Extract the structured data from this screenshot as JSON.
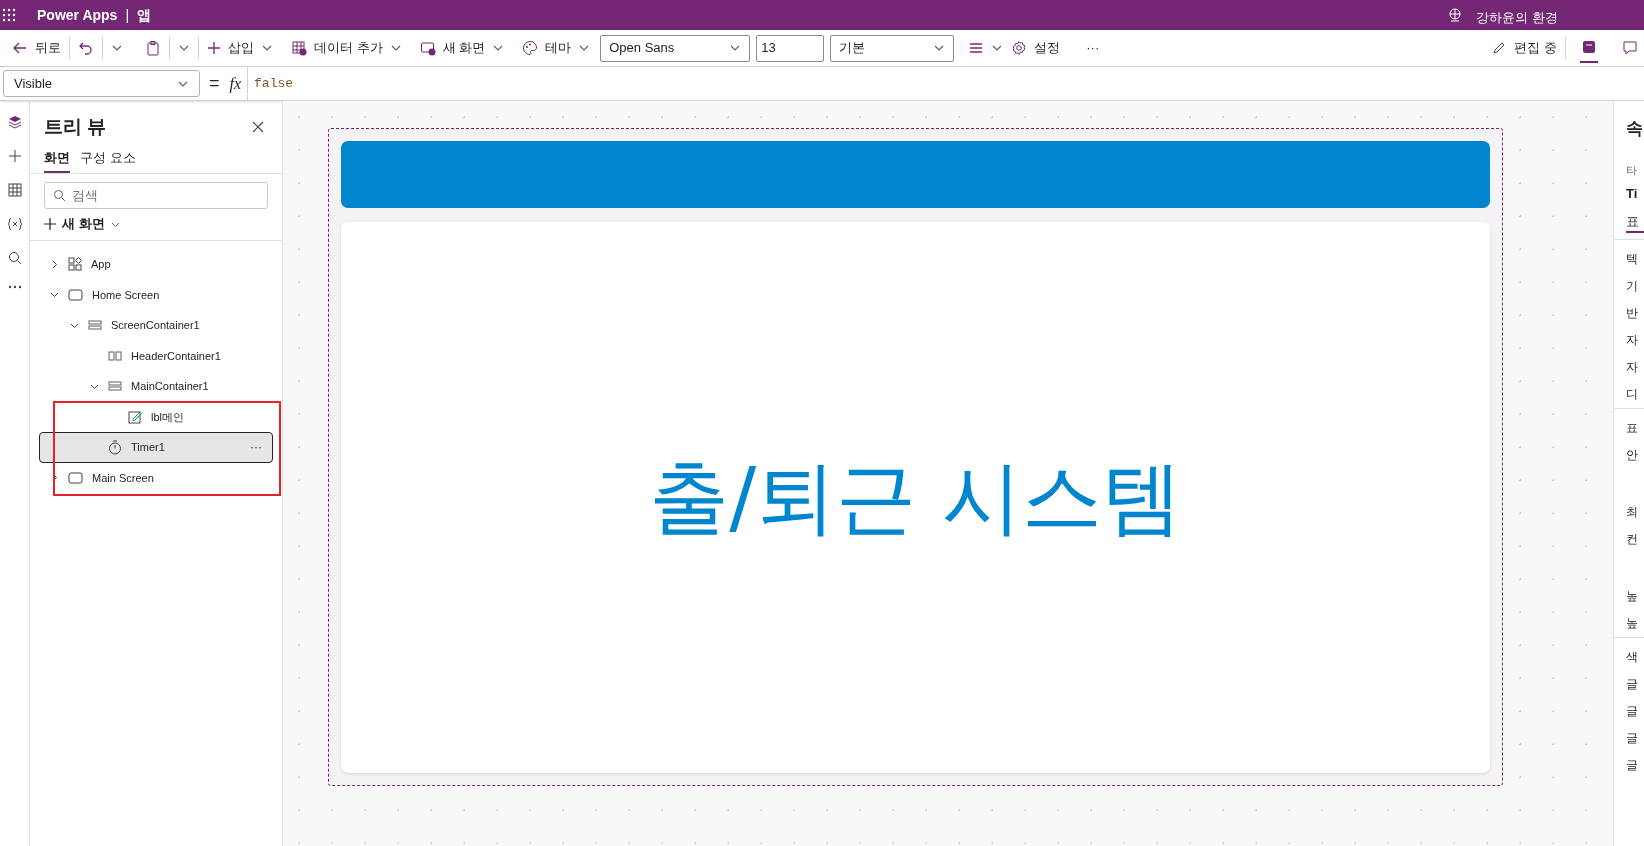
{
  "app_bar": {
    "product": "Power Apps",
    "separator": "|",
    "app_name": "앱",
    "environment": "강하윤의 환경"
  },
  "toolbar": {
    "back": "뒤로",
    "insert": "삽입",
    "add_data": "데이터 추가",
    "new_screen": "새 화면",
    "theme": "테마",
    "font": "Open Sans",
    "font_size": "13",
    "font_weight": "기본",
    "settings": "설정",
    "more": "···",
    "edit_state": "편집 중"
  },
  "formula_bar": {
    "property": "Visible",
    "equals": "=",
    "fx": "fx",
    "value": "false"
  },
  "tree_view": {
    "title": "트리 뷰",
    "tabs": [
      {
        "label": "화면",
        "selected": true
      },
      {
        "label": "구성 요소",
        "selected": false
      }
    ],
    "search": {
      "placeholder": "검색"
    },
    "new_screen": "새 화면",
    "items": [
      {
        "label": "App",
        "kind": "app",
        "expanded": false,
        "selected": false
      },
      {
        "label": "Home Screen",
        "kind": "screen",
        "expanded": true,
        "selected": false,
        "children": [
          {
            "label": "ScreenContainer1",
            "kind": "vcontainer",
            "expanded": true,
            "selected": false,
            "children": [
              {
                "label": "HeaderContainer1",
                "kind": "hcontainer",
                "selected": false
              },
              {
                "label": "MainContainer1",
                "kind": "vcontainer",
                "expanded": true,
                "selected": false,
                "children": [
                  {
                    "label": "lbl메인",
                    "kind": "label",
                    "selected": false
                  }
                ]
              },
              {
                "label": "Timer1",
                "kind": "timer",
                "selected": true,
                "more": "···"
              }
            ]
          }
        ]
      },
      {
        "label": "Main Screen",
        "kind": "screen",
        "expanded": false,
        "selected": false
      }
    ]
  },
  "canvas": {
    "main_label": "출/퇴근 시스템"
  },
  "properties_panel": {
    "title": "속",
    "type_label": "타",
    "type_value": "Ti",
    "tab": "표",
    "sections": [
      {
        "rows": [
          "텍",
          "기",
          "반",
          "자",
          "자",
          "디"
        ]
      },
      {
        "rows": [
          "표",
          "안",
          "최",
          "컨",
          "높",
          "높"
        ]
      },
      {
        "rows": [
          "색",
          "글",
          "글",
          "글",
          "글"
        ]
      }
    ]
  }
}
